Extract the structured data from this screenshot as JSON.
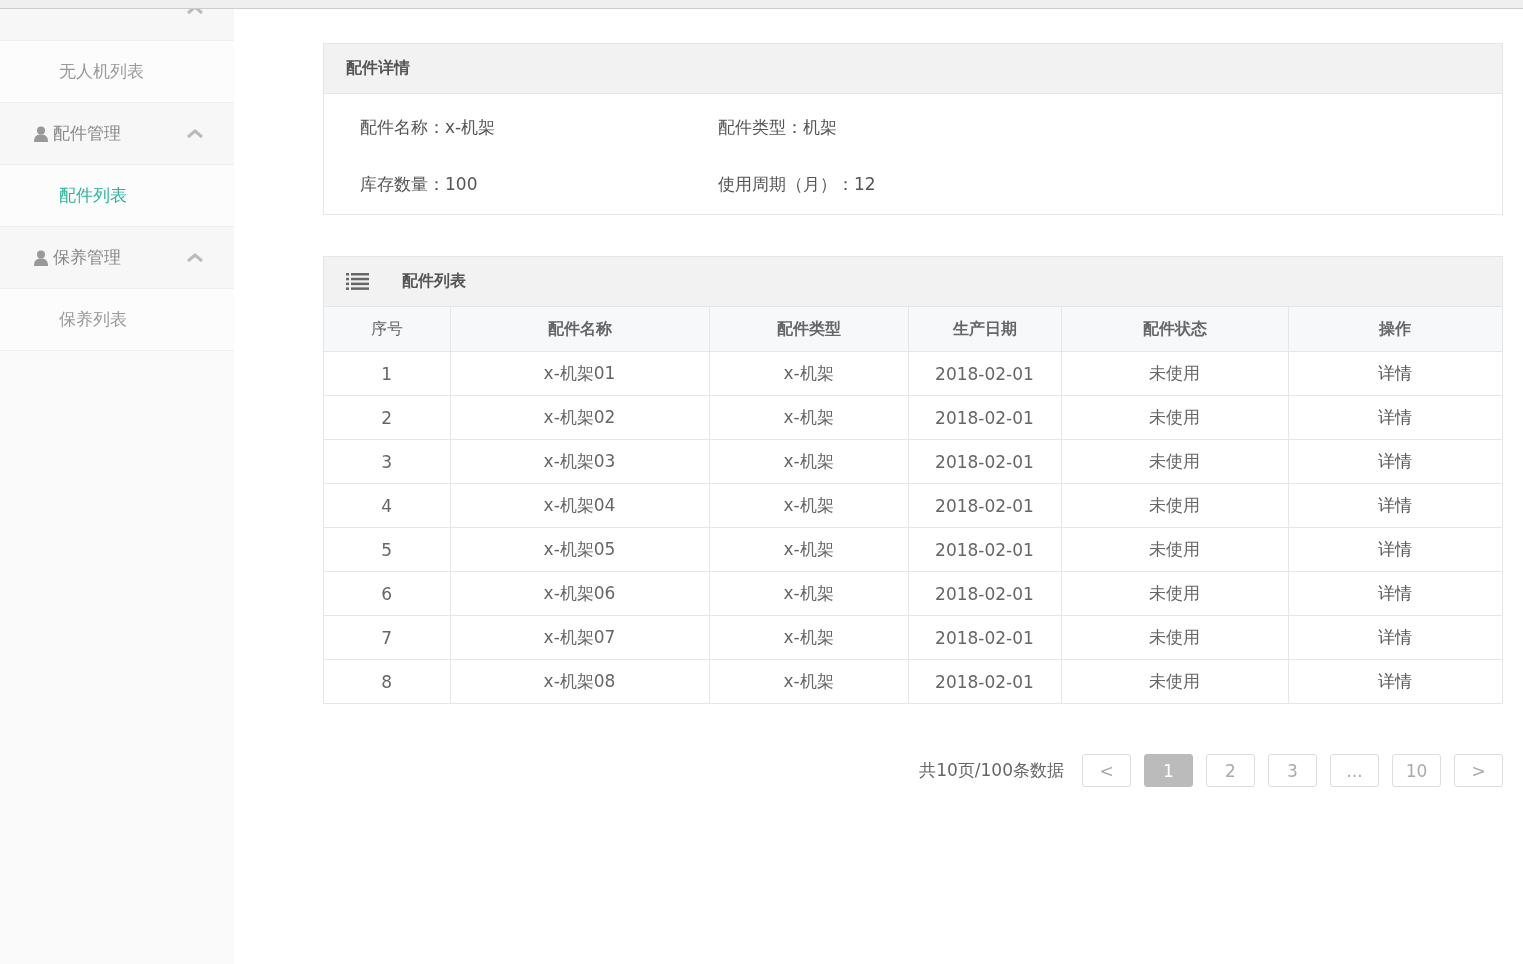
{
  "sidebar": {
    "groups": [
      {
        "expanded": true,
        "items": [
          {
            "label": "无人机列表",
            "selected": false
          }
        ]
      },
      {
        "label": "配件管理",
        "expanded": true,
        "items": [
          {
            "label": "配件列表",
            "selected": true
          }
        ]
      },
      {
        "label": "保养管理",
        "expanded": true,
        "items": [
          {
            "label": "保养列表",
            "selected": false
          }
        ]
      }
    ]
  },
  "detail": {
    "title": "配件详情",
    "fields": [
      {
        "label": "配件名称：",
        "value": "x-机架"
      },
      {
        "label": "配件类型：",
        "value": "机架"
      },
      {
        "label": "库存数量：",
        "value": "100"
      },
      {
        "label": "使用周期（月）：",
        "value": "12"
      }
    ]
  },
  "table": {
    "title": "配件列表",
    "columns": [
      "序号",
      "配件名称",
      "配件类型",
      "生产日期",
      "配件状态",
      "操作"
    ],
    "rows": [
      [
        "1",
        "x-机架01",
        "x-机架",
        "2018-02-01",
        "未使用",
        "详情"
      ],
      [
        "2",
        "x-机架02",
        "x-机架",
        "2018-02-01",
        "未使用",
        "详情"
      ],
      [
        "3",
        "x-机架03",
        "x-机架",
        "2018-02-01",
        "未使用",
        "详情"
      ],
      [
        "4",
        "x-机架04",
        "x-机架",
        "2018-02-01",
        "未使用",
        "详情"
      ],
      [
        "5",
        "x-机架05",
        "x-机架",
        "2018-02-01",
        "未使用",
        "详情"
      ],
      [
        "6",
        "x-机架06",
        "x-机架",
        "2018-02-01",
        "未使用",
        "详情"
      ],
      [
        "7",
        "x-机架07",
        "x-机架",
        "2018-02-01",
        "未使用",
        "详情"
      ],
      [
        "8",
        "x-机架08",
        "x-机架",
        "2018-02-01",
        "未使用",
        "详情"
      ]
    ]
  },
  "pagination": {
    "summary": "共10页/100条数据",
    "prev": "<",
    "next": ">",
    "pages": [
      {
        "label": "1",
        "selected": true
      },
      {
        "label": "2",
        "selected": false
      },
      {
        "label": "3",
        "selected": false
      },
      {
        "label": "...",
        "selected": false
      },
      {
        "label": "10",
        "selected": false
      }
    ]
  }
}
